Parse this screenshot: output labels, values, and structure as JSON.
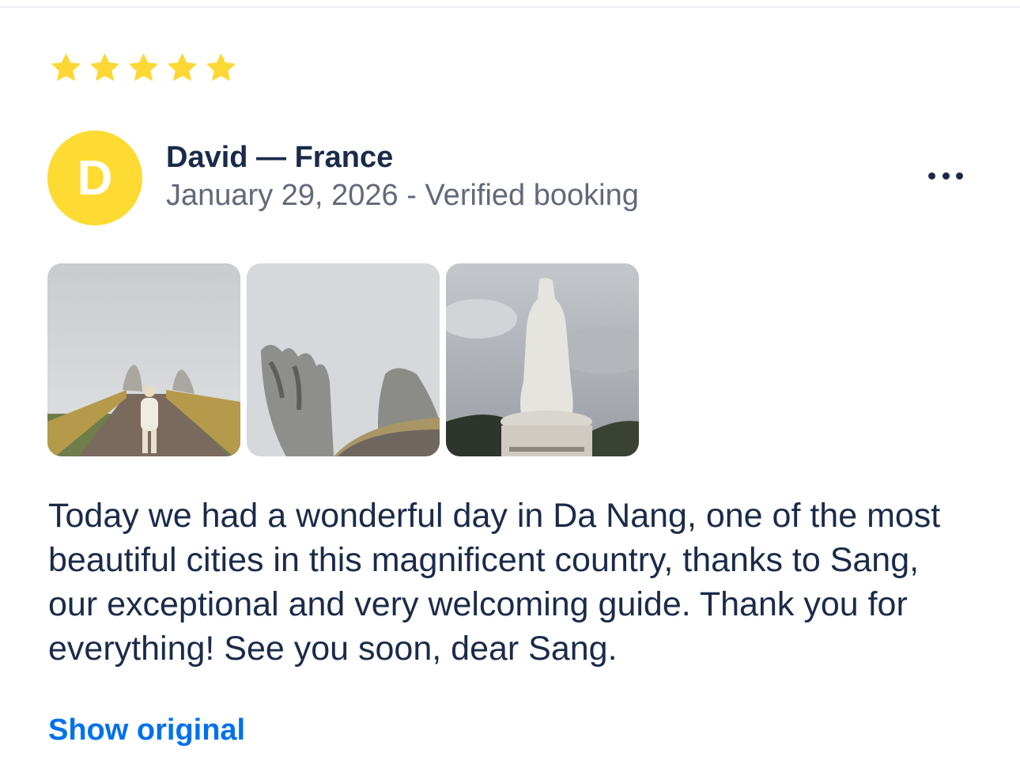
{
  "review": {
    "rating": 5,
    "rating_max": 5,
    "star_color": "#fdd835",
    "star_icon": "star-icon",
    "avatar_initial": "D",
    "avatar_color": "#fddb32",
    "reviewer_name": "David — France",
    "meta": "January 29, 2026 - Verified booking",
    "more_icon": "more-horizontal-icon",
    "photos": [
      {
        "name": "golden-bridge-walkway-photo"
      },
      {
        "name": "golden-bridge-hands-photo"
      },
      {
        "name": "lady-buddha-statue-photo"
      }
    ],
    "text": "Today we had a wonderful day in Da Nang, one of the most beautiful cities in this magnificent country, thanks to Sang, our exceptional and very welcoming guide. Thank you for everything! See you soon, dear Sang.",
    "show_original_label": "Show original",
    "link_color": "#0071eb"
  }
}
